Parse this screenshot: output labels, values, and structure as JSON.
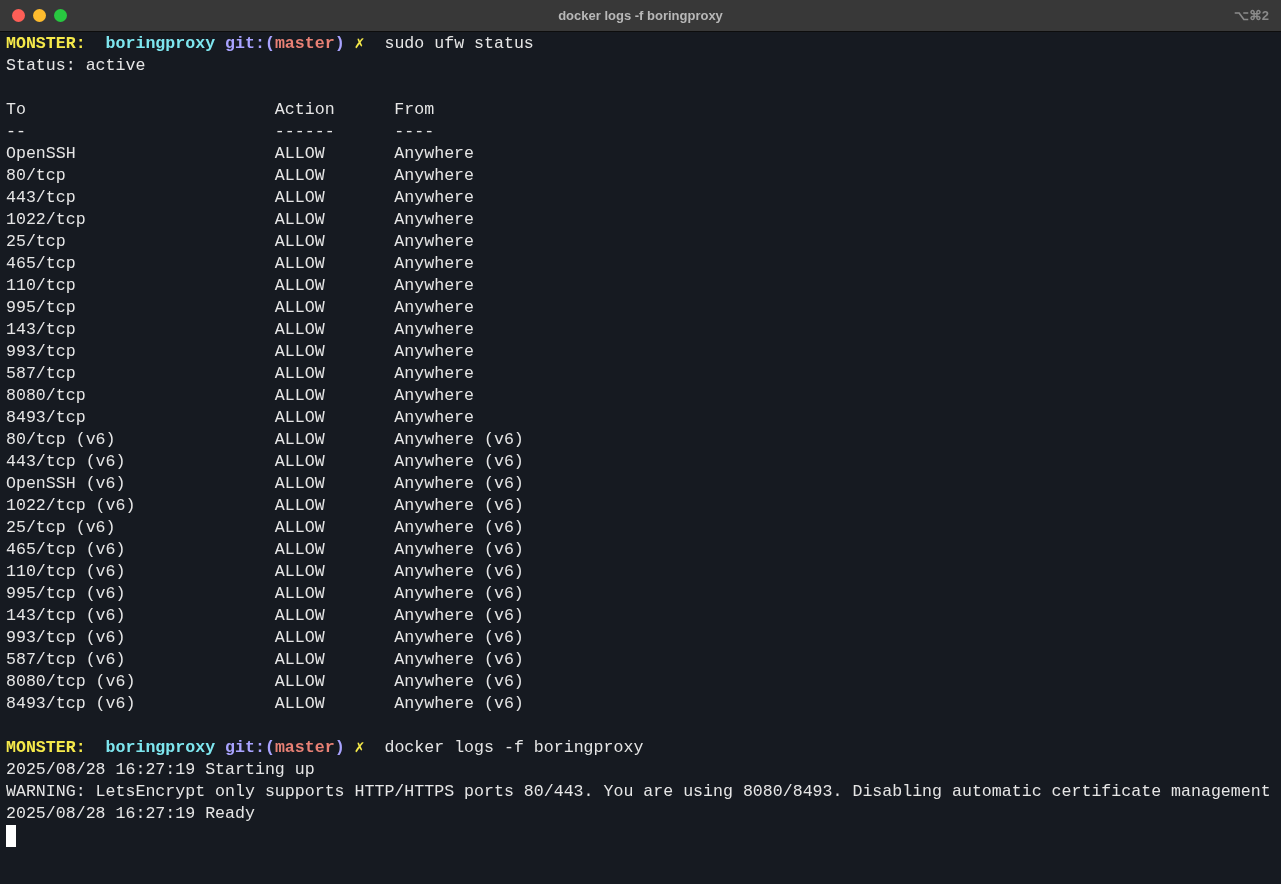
{
  "window": {
    "title": "docker logs -f boringproxy",
    "shortcut": "⌥⌘2"
  },
  "session": [
    {
      "kind": "prompt",
      "host": "MONSTER:",
      "directory": "boringproxy",
      "git_open": "git:(",
      "branch": "master",
      "git_close": ")",
      "dirty_mark": "✗",
      "command": "sudo ufw status"
    },
    {
      "kind": "output",
      "text": "Status: active"
    },
    {
      "kind": "blank"
    },
    {
      "kind": "table",
      "columns": [
        "To",
        "Action",
        "From"
      ],
      "rule": [
        "--",
        "------",
        "----"
      ],
      "rows": [
        [
          "OpenSSH",
          "ALLOW",
          "Anywhere"
        ],
        [
          "80/tcp",
          "ALLOW",
          "Anywhere"
        ],
        [
          "443/tcp",
          "ALLOW",
          "Anywhere"
        ],
        [
          "1022/tcp",
          "ALLOW",
          "Anywhere"
        ],
        [
          "25/tcp",
          "ALLOW",
          "Anywhere"
        ],
        [
          "465/tcp",
          "ALLOW",
          "Anywhere"
        ],
        [
          "110/tcp",
          "ALLOW",
          "Anywhere"
        ],
        [
          "995/tcp",
          "ALLOW",
          "Anywhere"
        ],
        [
          "143/tcp",
          "ALLOW",
          "Anywhere"
        ],
        [
          "993/tcp",
          "ALLOW",
          "Anywhere"
        ],
        [
          "587/tcp",
          "ALLOW",
          "Anywhere"
        ],
        [
          "8080/tcp",
          "ALLOW",
          "Anywhere"
        ],
        [
          "8493/tcp",
          "ALLOW",
          "Anywhere"
        ],
        [
          "80/tcp (v6)",
          "ALLOW",
          "Anywhere (v6)"
        ],
        [
          "443/tcp (v6)",
          "ALLOW",
          "Anywhere (v6)"
        ],
        [
          "OpenSSH (v6)",
          "ALLOW",
          "Anywhere (v6)"
        ],
        [
          "1022/tcp (v6)",
          "ALLOW",
          "Anywhere (v6)"
        ],
        [
          "25/tcp (v6)",
          "ALLOW",
          "Anywhere (v6)"
        ],
        [
          "465/tcp (v6)",
          "ALLOW",
          "Anywhere (v6)"
        ],
        [
          "110/tcp (v6)",
          "ALLOW",
          "Anywhere (v6)"
        ],
        [
          "995/tcp (v6)",
          "ALLOW",
          "Anywhere (v6)"
        ],
        [
          "143/tcp (v6)",
          "ALLOW",
          "Anywhere (v6)"
        ],
        [
          "993/tcp (v6)",
          "ALLOW",
          "Anywhere (v6)"
        ],
        [
          "587/tcp (v6)",
          "ALLOW",
          "Anywhere (v6)"
        ],
        [
          "8080/tcp (v6)",
          "ALLOW",
          "Anywhere (v6)"
        ],
        [
          "8493/tcp (v6)",
          "ALLOW",
          "Anywhere (v6)"
        ]
      ]
    },
    {
      "kind": "blank"
    },
    {
      "kind": "prompt",
      "host": "MONSTER:",
      "directory": "boringproxy",
      "git_open": "git:(",
      "branch": "master",
      "git_close": ")",
      "dirty_mark": "✗",
      "command": "docker logs -f boringproxy"
    },
    {
      "kind": "output",
      "text": "2025/08/28 16:27:19 Starting up"
    },
    {
      "kind": "output",
      "text": "WARNING: LetsEncrypt only supports HTTP/HTTPS ports 80/443. You are using 8080/8493. Disabling automatic certificate management"
    },
    {
      "kind": "output",
      "text": "2025/08/28 16:27:19 Ready"
    },
    {
      "kind": "cursor"
    }
  ]
}
